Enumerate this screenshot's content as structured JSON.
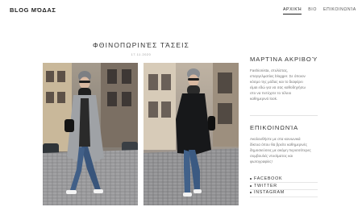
{
  "header": {
    "logo": "BLOG ΜΌΔΑΣ",
    "nav": [
      "ΑΡΧΙΚΉ",
      "ΒΙΟ",
      "ΕΠΙΚΟΙΝΩΝΊΑ"
    ],
    "active_nav": "ΑΡΧΙΚΉ"
  },
  "post": {
    "title": "ΦΘΙΝΟΠΩΡΙΝΈΣ ΤΆΣΕΙΣ",
    "date": "17.11.2020",
    "photos": [
      "photo-woman-grey-coat",
      "photo-woman-black-coat"
    ]
  },
  "sidebar": {
    "about": {
      "heading": "ΜΑΡΤΊΝΑ ΑΚΡΙΒΟΎ",
      "text_lines": [
        "Fashionista, στυλίστας,",
        "επαγγελματίας blogger. Σε όποιον",
        "κόσμο της μόδας και το διαφέρει",
        "είμαι εδώ για να σας καθοδηγήσω",
        "στο να πετύχετε το τέλειο",
        "καθημερινό look."
      ]
    },
    "contact": {
      "heading": "ΕΠΙΚΟΙΝΩΝΊΑ",
      "text_lines": [
        "Ακολουθήστε με στα κοινωνικά",
        "δίκτυα όπου θα βρείτε καθημερινές",
        "δημοσιεύσεις με ακόμη περισσότερες",
        "συμβουλές ντυσίματος και",
        "φωτογραφίες!"
      ]
    },
    "social": [
      "FACEBOOK",
      "TWITTER",
      "INSTAGRAM"
    ]
  },
  "colors": {
    "text_dark": "#333333",
    "text_muted": "#777777",
    "rule": "#e2e2e2"
  }
}
